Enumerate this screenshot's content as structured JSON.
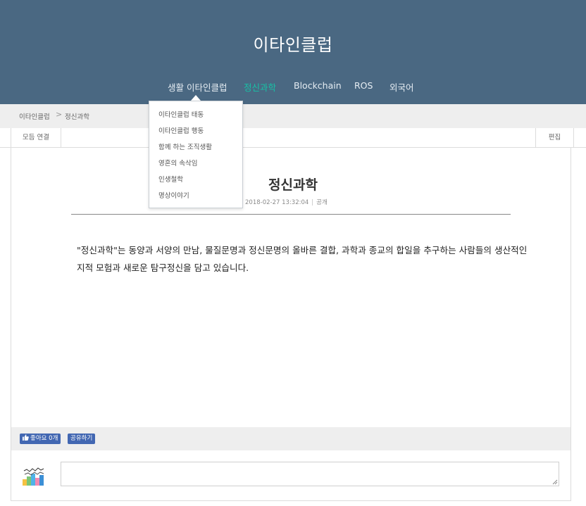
{
  "header": {
    "site_title": "이타인클럽",
    "nav": [
      "생활 이타인클럽",
      "정신과학",
      "Blockchain",
      "ROS",
      "외국어"
    ],
    "active_color": "#17c2a6",
    "background": "#4a6882"
  },
  "dropdown": {
    "items": [
      "이타인클럽 태동",
      "이타인클럽 행동",
      "함께 하는 조직생활",
      "영혼의 속삭임",
      "인생철학",
      "명상이야기"
    ]
  },
  "breadcrumb": {
    "home": "이타인클럽",
    "separator": ">",
    "current": "정신과학"
  },
  "toolbar": {
    "all_links": "모듬 연결",
    "edit": "편집"
  },
  "post": {
    "title": "정신과학",
    "date": "2018-02-27 13:32:04",
    "meta_separator": "|",
    "visibility": "공개",
    "body": "\"정신과학\"는 동양과 서양의 만남, 물질문명과 정신문명의 올바른 결합, 과학과 종교의 합일을 추구하는 사람들의 생산적인 지적 모험과 새로운 탐구정신을 담고 있습니다."
  },
  "social": {
    "like_label": "좋아요 0개",
    "share_label": "공유하기",
    "button_color": "#4267b2"
  },
  "comment": {
    "input_value": ""
  },
  "icons": {
    "like": "thumbs-up-icon",
    "avatar": "default-avatar",
    "resize": "resize-grip-icon"
  }
}
